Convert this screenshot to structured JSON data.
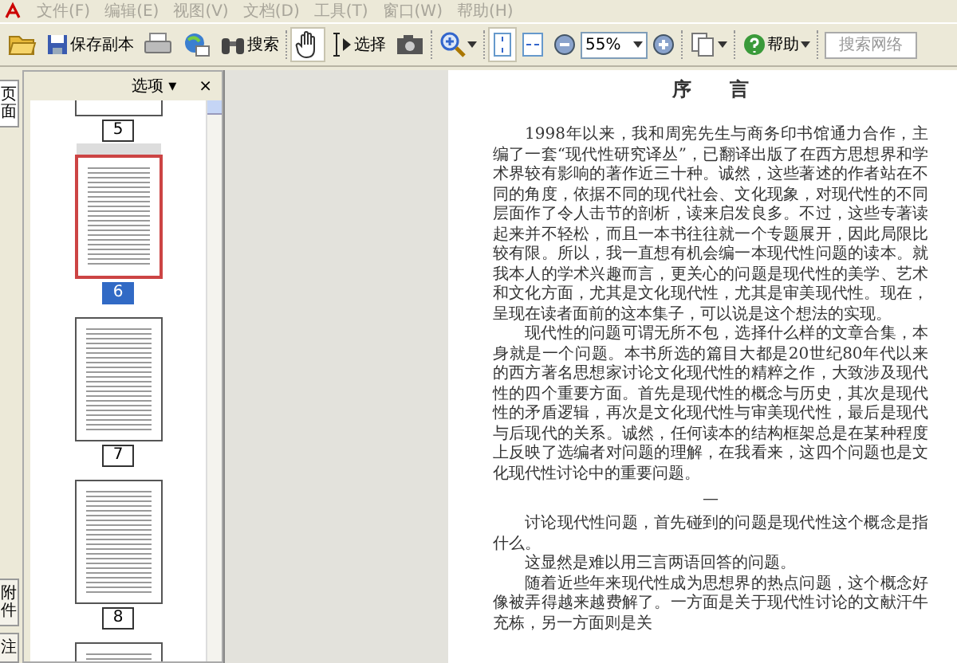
{
  "menu": [
    {
      "label": "文件(F)"
    },
    {
      "label": "编辑(E)"
    },
    {
      "label": "视图(V)"
    },
    {
      "label": "文档(D)"
    },
    {
      "label": "工具(T)"
    },
    {
      "label": "窗口(W)"
    },
    {
      "label": "帮助(H)"
    }
  ],
  "toolbar": [
    {
      "kind": "button",
      "selected": false,
      "menu": false
    },
    {
      "kind": "button",
      "label": "保存副本",
      "selected": false,
      "menu": false
    },
    {
      "kind": "button",
      "selected": false,
      "menu": false
    },
    {
      "kind": "button",
      "selected": false,
      "menu": false
    },
    {
      "kind": "button",
      "label": "搜索",
      "selected": false,
      "menu": false
    },
    {
      "kind": "separator"
    },
    {
      "kind": "button",
      "selected": true,
      "menu": false
    },
    {
      "kind": "button",
      "label": "选择",
      "selected": false,
      "menu": false
    },
    {
      "kind": "button",
      "selected": false,
      "menu": false
    },
    {
      "kind": "separator"
    },
    {
      "kind": "button",
      "selected": false,
      "menu": true
    },
    {
      "kind": "separator"
    },
    {
      "kind": "button",
      "selected": true,
      "menu": false
    },
    {
      "kind": "button",
      "selected": false,
      "menu": false
    },
    {
      "kind": "button",
      "selected": false,
      "menu": false
    },
    {
      "kind": "zoomfield",
      "value": "55%"
    },
    {
      "kind": "button",
      "selected": false,
      "menu": false
    },
    {
      "kind": "separator"
    },
    {
      "kind": "button",
      "selected": false,
      "menu": true
    },
    {
      "kind": "separator"
    },
    {
      "kind": "button",
      "label": "帮助",
      "selected": false,
      "menu": true
    },
    {
      "kind": "separator"
    },
    {
      "kind": "search",
      "placeholder": "搜索网络"
    }
  ],
  "side_tabs": [
    {
      "label": "页面",
      "selected": true
    },
    {
      "label": "附件",
      "selected": false
    },
    {
      "label": "注",
      "selected": false
    }
  ],
  "sidebar": {
    "options": "选项",
    "options_caret": "▾",
    "close": "×",
    "thumbnails": [
      {
        "label": "5",
        "selected": false
      },
      {
        "label": "6",
        "selected": true
      },
      {
        "label": "7",
        "selected": false
      },
      {
        "label": "8",
        "selected": false
      },
      {
        "selected": false
      }
    ]
  },
  "document": {
    "title": "序　　言",
    "paragraphs": [
      "1998年以来，我和周宪先生与商务印书馆通力合作，主编了一套“现代性研究译丛”，已翻译出版了在西方思想界和学术界较有影响的著作近三十种。诚然，这些著述的作者站在不同的角度，依据不同的现代社会、文化现象，对现代性的不同层面作了令人击节的剖析，读来启发良多。不过，这些专著读起来并不轻松，而且一本书往往就一个专题展开，因此局限比较有限。所以，我一直想有机会编一本现代性问题的读本。就我本人的学术兴趣而言，更关心的问题是现代性的美学、艺术和文化方面，尤其是文化现代性，尤其是审美现代性。现在，呈现在读者面前的这本集子，可以说是这个想法的实现。",
      "现代性的问题可谓无所不包，选择什么样的文章合集，本身就是一个问题。本书所选的篇目大都是20世纪80年代以来的西方著名思想家讨论文化现代性的精粹之作，大致涉及现代性的四个重要方面。首先是现代性的概念与历史，其次是现代性的矛盾逻辑，再次是文化现代性与审美现代性，最后是现代与后现代的关系。诚然，任何读本的结构框架总是在某种程度上反映了选编者对问题的理解，在我看来，这四个问题也是文化现代性讨论中的重要问题。"
    ],
    "page_number": "—",
    "next_paragraphs": [
      "讨论现代性问题，首先碰到的问题是现代性这个概念是指什么。",
      "这显然是难以用三言两语回答的问题。",
      "随着近些年来现代性成为思想界的热点问题，这个概念好像被弄得越来越费解了。一方面是关于现代性讨论的文献汗牛充栋，另一方面则是关"
    ]
  }
}
